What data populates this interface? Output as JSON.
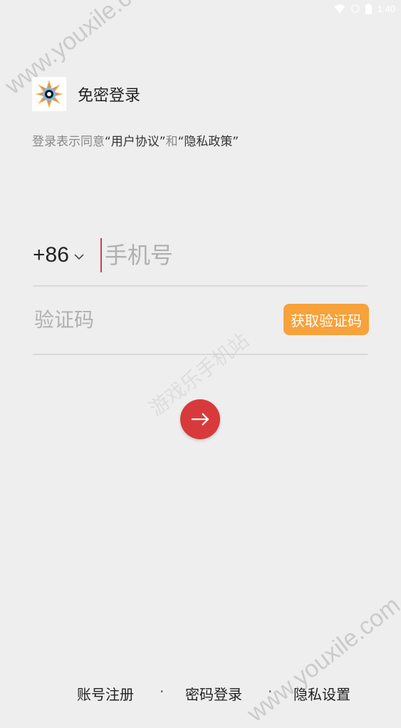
{
  "status_bar": {
    "time": "1:40",
    "icons": [
      "wifi-icon",
      "signal-icon",
      "battery-icon"
    ]
  },
  "header": {
    "logo_icon": "app-logo",
    "title": "免密登录"
  },
  "agreement": {
    "prefix": "登录表示同意",
    "user_agreement": "“用户协议”",
    "and": "和",
    "privacy_policy": "“隐私政策”"
  },
  "phone": {
    "country_code": "+86",
    "placeholder": "手机号",
    "value": ""
  },
  "code": {
    "placeholder": "验证码",
    "value": "",
    "get_code_label": "获取验证码"
  },
  "submit": {
    "icon": "arrow-right-icon"
  },
  "footer": {
    "register": "账号注册",
    "separator": "·",
    "password_login": "密码登录",
    "privacy_settings": "隐私设置"
  },
  "watermark": {
    "site": "www.youxile.com",
    "site_cn": "游戏乐手机站"
  },
  "colors": {
    "background": "#eeeeee",
    "accent_red": "#d83a3c",
    "accent_orange": "#f7a23a",
    "caret": "#d0385a"
  }
}
